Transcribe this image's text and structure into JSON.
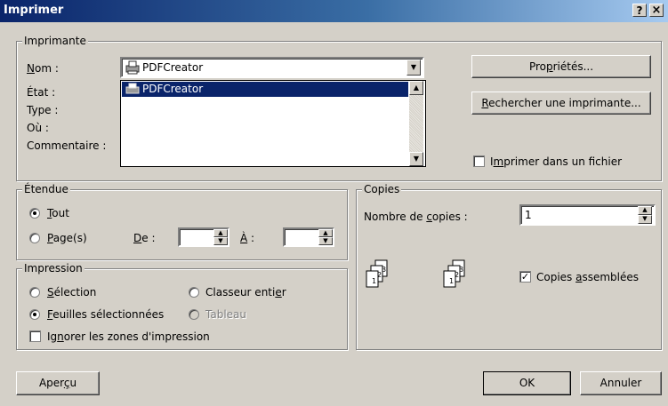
{
  "window": {
    "title": "Imprimer",
    "help_btn": "?",
    "close_btn": "×"
  },
  "printer": {
    "group_label": "Imprimante",
    "name_label": "Nom :",
    "state_label": "État :",
    "type_label": "Type :",
    "where_label": "Où :",
    "comment_label": "Commentaire :",
    "selected": "PDFCreator",
    "list_items": [
      "PDFCreator"
    ],
    "properties_btn": "Propriétés...",
    "find_btn": "Rechercher une imprimante...",
    "print_to_file_label": "Imprimer dans un fichier",
    "print_to_file_checked": false
  },
  "range": {
    "group_label": "Étendue",
    "all_label": "Tout",
    "pages_label": "Page(s)",
    "from_label": "De :",
    "to_label": "À :",
    "from_value": "",
    "to_value": "",
    "selected": "all"
  },
  "print_what": {
    "group_label": "Impression",
    "selection_label": "Sélection",
    "whole_workbook_label": "Classeur entier",
    "active_sheets_label": "Feuilles sélectionnées",
    "table_label": "Tableau",
    "ignore_areas_label": "Ignorer les zones d'impression",
    "selected": "active_sheets",
    "ignore_areas_checked": false
  },
  "copies": {
    "group_label": "Copies",
    "count_label": "Nombre de copies :",
    "count_value": "1",
    "collate_label": "Copies assemblées",
    "collate_checked": true,
    "icon_labels": [
      "1",
      "2",
      "3"
    ]
  },
  "footer": {
    "preview_btn": "Aperçu",
    "ok_btn": "OK",
    "cancel_btn": "Annuler"
  }
}
